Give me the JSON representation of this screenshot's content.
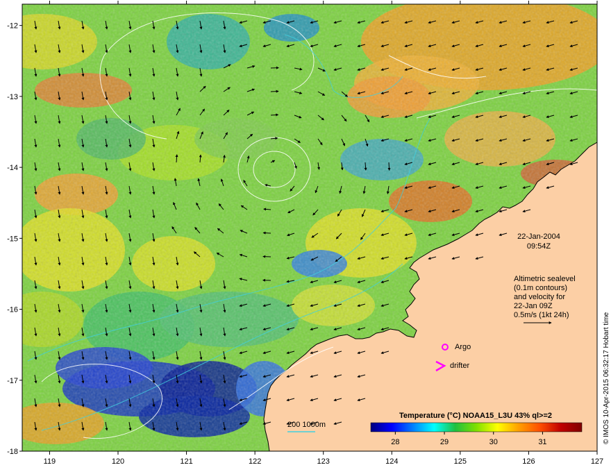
{
  "map": {
    "lon_range": [
      118.6,
      127
    ],
    "lat_range": [
      -18,
      -11.7
    ],
    "x_ticks": [
      "119",
      "120",
      "121",
      "122",
      "123",
      "124",
      "125",
      "126",
      "127"
    ],
    "y_ticks": [
      "-12",
      "-13",
      "-14",
      "-15",
      "-16",
      "-17",
      "-18"
    ]
  },
  "annotation": {
    "date": "22-Jan-2004",
    "time": "09:54Z",
    "legend_lines": [
      "Altimetric sealevel",
      "(0.1m contours)",
      "and velocity for",
      "22-Jan 09Z",
      "0.5m/s (1kt 24h)"
    ]
  },
  "markers": {
    "argo_label": "Argo",
    "drifter_label": "drifter",
    "argo_color": "#ff00ff",
    "drifter_color": "#ff00ff"
  },
  "bathymetry_legend": "200  1000m",
  "colorbar": {
    "title": "Temperature (°C) NOAA15_L3U 43% ql>=2",
    "ticks": [
      "28",
      "29",
      "30",
      "31"
    ],
    "range": [
      27.5,
      31.8
    ],
    "colors": [
      "#00007f",
      "#0000ff",
      "#0080ff",
      "#00ffff",
      "#20c040",
      "#80e000",
      "#ffff00",
      "#ffa000",
      "#ff5000",
      "#c00000",
      "#800000"
    ]
  },
  "land_color": "#fccfa5",
  "credit": "© IMOS 10-Apr-2015 06:32:17 Hobart time"
}
